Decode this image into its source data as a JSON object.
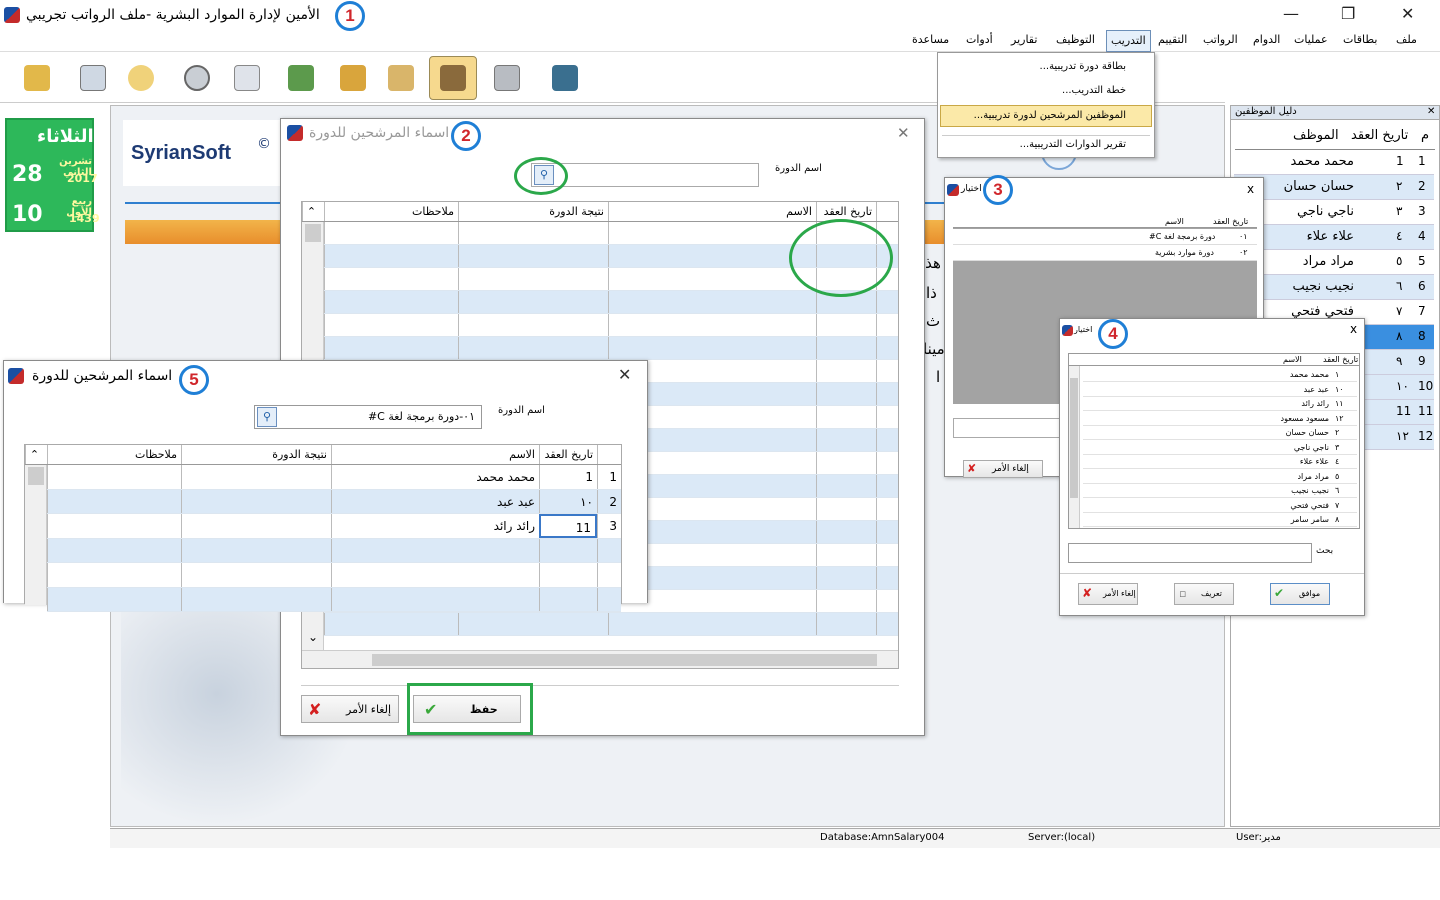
{
  "window": {
    "title": "الأمين لإدارة الموارد البشرية -ملف الرواتب تجريبي",
    "min": "—",
    "max": "❐",
    "close": "✕"
  },
  "callouts": [
    "1",
    "2",
    "3",
    "4",
    "5"
  ],
  "menu": [
    "ملف",
    "بطاقات",
    "عمليات",
    "الدوام",
    "الرواتب",
    "التقييم",
    "التدريب",
    "التوظيف",
    "تقارير",
    "أدوات",
    "مساعدة"
  ],
  "training_menu": {
    "items": [
      "بطاقة دورة تدريبية...",
      "خطة التدريب...",
      "الموظفين المرشحين لدورة تدريبية...",
      "تقرير الدوارات التدريبية..."
    ]
  },
  "toolbar": {
    "icons": [
      "exit-icon",
      "employee-card-icon",
      "pin-icon",
      "clock-icon",
      "schedule-icon",
      "payroll-icon",
      "books-icon",
      "documents-icon",
      "candidates-icon",
      "calculator-icon",
      "logout-icon"
    ]
  },
  "calendar": {
    "day_name": "الثلاثاء",
    "greg_day": "28",
    "greg_month": "تشرين الثاني",
    "greg_year": "2017",
    "hijri_day": "10",
    "hijri_month": "ربيع الأول",
    "hijri_year": "1439"
  },
  "brand": {
    "name": "SyrianSoft",
    "mark": "©"
  },
  "bg_text": [
    "هذا",
    "ذا",
    "م ث",
    "مينا",
    "ا"
  ],
  "employee_guide": {
    "title": "دليل الموظفين",
    "close": "✕",
    "headers": [
      "م",
      "تاريخ العقد",
      "الموظف"
    ],
    "rows": [
      [
        "1",
        "1",
        "محمد محمد"
      ],
      [
        "2",
        "٢",
        "حسان حسان"
      ],
      [
        "3",
        "٣",
        "ناجي ناجي"
      ],
      [
        "4",
        "٤",
        "علاء علاء"
      ],
      [
        "5",
        "٥",
        "مراد مراد"
      ],
      [
        "6",
        "٦",
        "نجيب نجيب"
      ],
      [
        "7",
        "٧",
        "فتحي فتحي"
      ],
      [
        "8",
        "٨",
        ""
      ],
      [
        "9",
        "٩",
        ""
      ],
      [
        "10",
        "١٠",
        ""
      ],
      [
        "11",
        "11",
        ""
      ],
      [
        "12",
        "١٢",
        ""
      ]
    ]
  },
  "dialog2": {
    "title": "اسماء المرشحين للدورة",
    "course_label": "اسم الدورة",
    "course_value": "",
    "headers": [
      "تاريخ العقد",
      "الاسم",
      "نتيجة الدورة",
      "ملاحظات"
    ],
    "save": "حفظ",
    "cancel": "إلغاء الأمر",
    "close": "✕"
  },
  "dialog3": {
    "title": "اختيار",
    "close": "x",
    "headers": [
      "تاريخ العقد",
      "الاسم"
    ],
    "rows": [
      [
        "٠١",
        "دورة برمجة لغة C#"
      ],
      [
        "٠٢",
        "دورة موارد بشرية"
      ]
    ],
    "cancel": "إلغاء الأمر"
  },
  "dialog4": {
    "title": "اختيار",
    "close": "x",
    "headers": [
      "تاريخ العقد",
      "الاسم"
    ],
    "rows": [
      [
        "١",
        "محمد محمد"
      ],
      [
        "١٠",
        "عبد عبد"
      ],
      [
        "١١",
        "رائد رائد"
      ],
      [
        "١٢",
        "مسعود مسعود"
      ],
      [
        "٢",
        "حسان حسان"
      ],
      [
        "٣",
        "ناجي ناجي"
      ],
      [
        "٤",
        "علاء علاء"
      ],
      [
        "٥",
        "مراد مراد"
      ],
      [
        "٦",
        "نجيب نجيب"
      ],
      [
        "٧",
        "فتحي فتحي"
      ],
      [
        "٨",
        "سامر سامر"
      ]
    ],
    "search_label": "بحث",
    "ok": "موافق",
    "define": "تعريف",
    "cancel": "إلغاء الأمر"
  },
  "dialog5": {
    "title": "اسماء المرشحين للدورة",
    "course_label": "اسم الدورة",
    "course_value": "٠١-دورة برمجة لغة C#",
    "headers": [
      "تاريخ العقد",
      "الاسم",
      "نتيجة الدورة",
      "ملاحظات"
    ],
    "rows": [
      [
        "1",
        "1",
        "محمد محمد"
      ],
      [
        "2",
        "١٠",
        "عبد عبد"
      ],
      [
        "3",
        "11",
        "رائد رائد"
      ]
    ],
    "close": "✕"
  },
  "status": {
    "database": "Database:AmnSalary004",
    "server": "Server:(local)",
    "user": "User:مدير"
  }
}
